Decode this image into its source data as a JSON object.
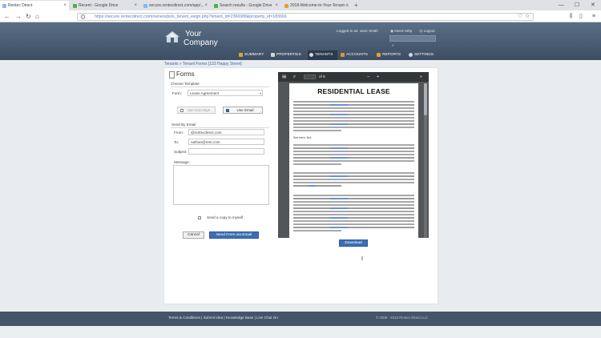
{
  "browser": {
    "tabs": [
      {
        "label": "Rentec Direct",
        "active": true
      },
      {
        "label": "Recent - Google Drive",
        "active": false
      },
      {
        "label": "secure.rentecdirect.com/app/...",
        "active": false
      },
      {
        "label": "Search results - Google Drive",
        "active": false
      },
      {
        "label": "2018-Welcome-to-Your-Tenant-...",
        "active": false
      }
    ],
    "new_tab": "+",
    "url": "https://secure.rentecdirect.com/owners/pick_tenant_esign.php?tenant_id=2366988&property_id=183669",
    "back": "←",
    "forward": "→",
    "reload": "↻",
    "home": "⌂"
  },
  "header": {
    "logo_line1": "Your",
    "logo_line2": "Company",
    "logged_in": "Logged in as: Jane Smith",
    "need_help": "Need Help",
    "logout": "Logout",
    "menu": [
      {
        "label": "SUMMARY",
        "icon": "summary-icon",
        "color": "#e0a23b",
        "active": false
      },
      {
        "label": "PROPERTIES",
        "icon": "house-icon",
        "color": "#d5d5d5",
        "active": false
      },
      {
        "label": "TENANTS",
        "icon": "people-icon",
        "color": "#cfd8e3",
        "active": true
      },
      {
        "label": "ACCOUNTS",
        "icon": "ledger-icon",
        "color": "#d49a3a",
        "active": false
      },
      {
        "label": "REPORTS",
        "icon": "chart-icon",
        "color": "#e0a23b",
        "active": false
      },
      {
        "label": "SETTINGS",
        "icon": "gear-icon",
        "color": "#cfd8e3",
        "active": false
      }
    ]
  },
  "breadcrumb": "Tenants » Tenant Forms [123 Happy Street]",
  "forms": {
    "title": "Forms",
    "choose_template": "Choose Template",
    "form_label": "Form:",
    "form_value": "Lease Agreement",
    "use_docusign": "Use Docusign",
    "use_email": "Use Email",
    "send_by_email": "Send By Email",
    "from_label": "From:",
    "from_value": "@rentecdirect.com",
    "to_label": "To:",
    "to_value": "nathan@rent.com",
    "subject_label": "Subject:",
    "message_label": "Message:",
    "copy_myself": "Send a copy to myself",
    "cancel": "Cancel",
    "send": "Send Form via Email"
  },
  "viewer": {
    "page_indicator": "of 6",
    "zoom_out": "−",
    "zoom_in": "+",
    "doc_title": "RESIDENTIAL LEASE",
    "see_here": "See here:  N/A",
    "download": "Download"
  },
  "footer": {
    "links": "Terms & Conditions  |  Submit Idea  |  Knowledge Base  |  Live Chat On",
    "copyright": "© 2008 - 2018 Rentec Direct LLC"
  },
  "colors": {
    "header": "#4a5d75",
    "accent": "#3b6fb6",
    "footer": "#44546a"
  }
}
